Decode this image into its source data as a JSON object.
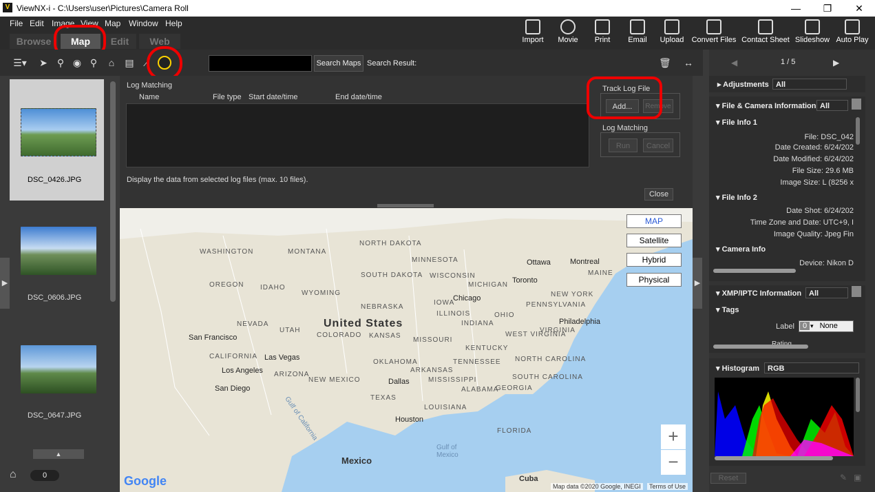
{
  "window": {
    "title": "ViewNX-i - C:\\Users\\user\\Pictures\\Camera Roll",
    "controls": [
      "—",
      "❐",
      "✕"
    ]
  },
  "menu": [
    "File",
    "Edit",
    "Image",
    "View",
    "Map",
    "Window",
    "Help"
  ],
  "modes": [
    "Browse",
    "Map",
    "Edit",
    "Web"
  ],
  "toolbar": [
    "Import",
    "Movie",
    "Print",
    "Email",
    "Upload",
    "Convert Files",
    "Contact Sheet",
    "Slideshow",
    "Auto Play"
  ],
  "search": {
    "button": "Search Maps",
    "result_label": "Search Result:"
  },
  "filmstrip": {
    "items": [
      "DSC_0426.JPG",
      "DSC_0606.JPG",
      "DSC_0647.JPG"
    ],
    "count": "0"
  },
  "log": {
    "title": "Log Matching",
    "columns": [
      "Name",
      "File type",
      "Start date/time",
      "End date/time"
    ],
    "note": "Display the data from selected log files (max. 10 files).",
    "close": "Close",
    "track_group": "Track Log File",
    "add": "Add...",
    "remove": "Remove",
    "match_group": "Log Matching",
    "run": "Run",
    "cancel": "Cancel"
  },
  "map": {
    "types": [
      "MAP",
      "Satellite",
      "Hybrid",
      "Physical"
    ],
    "country": "United States",
    "regions": [
      "WASHINGTON",
      "MONTANA",
      "NORTH DAKOTA",
      "MINNESOTA",
      "OREGON",
      "IDAHO",
      "SOUTH DAKOTA",
      "WISCONSIN",
      "MICHIGAN",
      "WYOMING",
      "NEBRASKA",
      "IOWA",
      "NEVADA",
      "UTAH",
      "COLORADO",
      "KANSAS",
      "ILLINOIS",
      "INDIANA",
      "OHIO",
      "PENNSYLVANIA",
      "NEW YORK",
      "CALIFORNIA",
      "ARIZONA",
      "NEW MEXICO",
      "OKLAHOMA",
      "MISSOURI",
      "KENTUCKY",
      "WEST VIRGINIA",
      "VIRGINIA",
      "TENNESSEE",
      "NORTH CAROLINA",
      "SOUTH CAROLINA",
      "ARKANSAS",
      "MISSISSIPPI",
      "ALABAMA",
      "GEORGIA",
      "TEXAS",
      "LOUISIANA",
      "FLORIDA",
      "MAINE"
    ],
    "cities": [
      "San Francisco",
      "Las Vegas",
      "Los Angeles",
      "San Diego",
      "Chicago",
      "Dallas",
      "Houston",
      "Toronto",
      "Ottawa",
      "Montreal",
      "Philadelphia"
    ],
    "water": [
      "Gulf of California",
      "Gulf of Mexico"
    ],
    "other": [
      "Mexico",
      "Cuba"
    ],
    "attribution": "Map data ©2020 Google, INEGI",
    "terms": "Terms of Use",
    "logo": "Google",
    "zoom_in": "+",
    "zoom_out": "−"
  },
  "right": {
    "pager": "1 / 5",
    "adjustments": {
      "title": "Adjustments",
      "value": "All"
    },
    "fileinfo": {
      "title": "File & Camera Information",
      "value": "All"
    },
    "fileinfo1": {
      "title": "File Info 1",
      "rows": [
        "File:  DSC_042",
        "Date Created:  6/24/202",
        "Date Modified:  6/24/202",
        "File Size:  29.6 MB",
        "Image Size:  L (8256 x"
      ]
    },
    "fileinfo2": {
      "title": "File Info 2",
      "rows": [
        "Date Shot:  6/24/202",
        "Time Zone and Date:  UTC+9, I",
        "Image Quality:  Jpeg Fin"
      ]
    },
    "camerainfo": {
      "title": "Camera Info",
      "rows": [
        "Device:  Nikon D"
      ]
    },
    "xmp": {
      "title": "XMP/IPTC Information",
      "value": "All"
    },
    "tags": {
      "title": "Tags",
      "label": "Label",
      "label_num": "0",
      "label_value": "None",
      "rating": "Rating"
    },
    "histogram": {
      "title": "Histogram",
      "value": "RGB"
    },
    "reset": "Reset"
  }
}
